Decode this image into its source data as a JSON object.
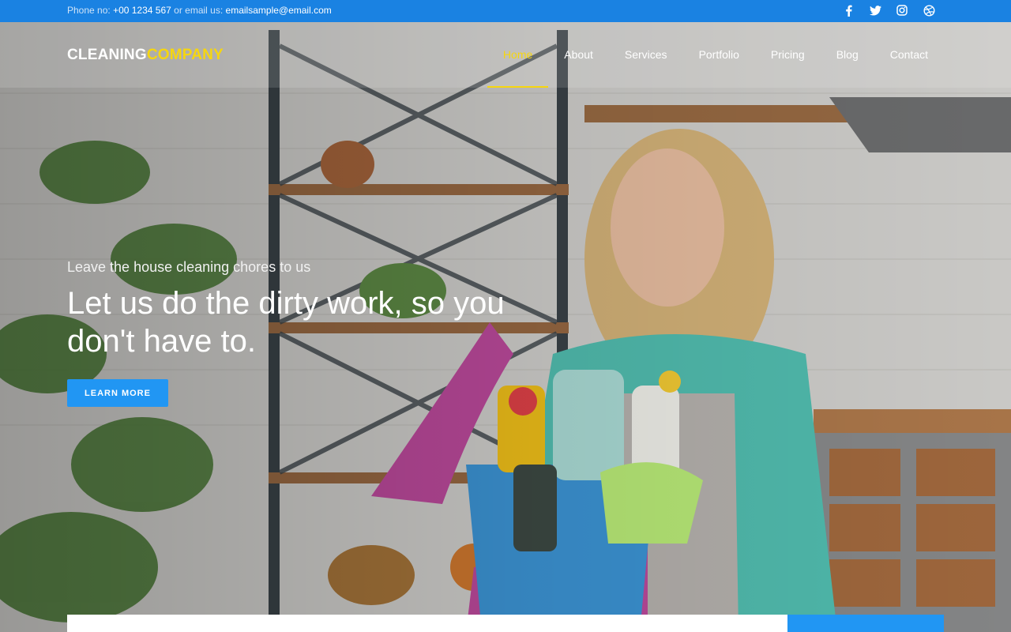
{
  "topbar": {
    "phone_label": "Phone no:",
    "phone_value": "+00 1234 567",
    "or_label": "or",
    "email_label": "email us:",
    "email_value": "emailsample@email.com",
    "social": [
      "facebook-icon",
      "twitter-icon",
      "instagram-icon",
      "dribbble-icon"
    ]
  },
  "brand": {
    "part1": "CLEANING",
    "part2": "COMPANY"
  },
  "nav": {
    "items": [
      "Home",
      "About",
      "Services",
      "Portfolio",
      "Pricing",
      "Blog",
      "Contact"
    ],
    "active": "Home"
  },
  "hero": {
    "kicker": "Leave the house cleaning chores to us",
    "headline": "Let us do the dirty work, so you don't have to.",
    "cta": "LEARN MORE",
    "image": "woman-holding-cleaning-supplies-photo"
  },
  "colors": {
    "topbar": "#1a82e2",
    "accent": "#f6d60f",
    "button": "#2196f3"
  }
}
